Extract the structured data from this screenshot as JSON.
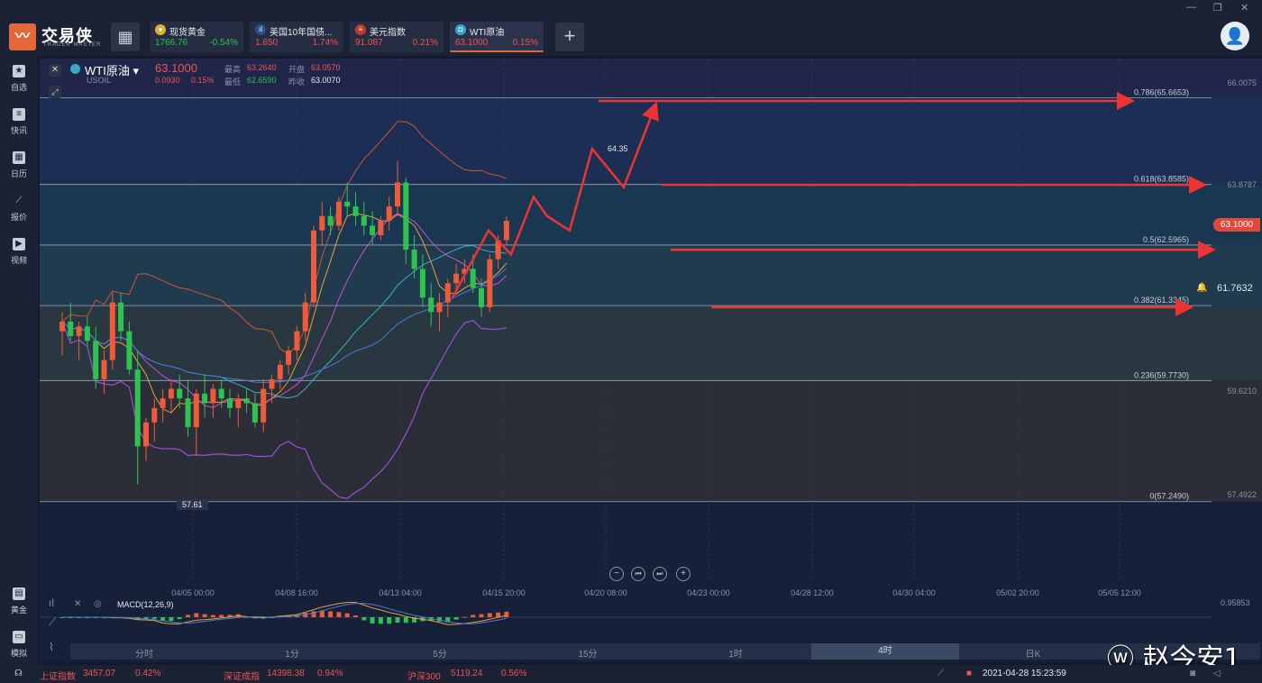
{
  "app": {
    "name": "交易侠",
    "subtitle": "TRADER MASTER"
  },
  "tabs": [
    {
      "name": "现货黄金",
      "price": "1766.76",
      "change": "-0.54%",
      "icon": "gold-coin-icon",
      "price_color": "#26c24f",
      "change_color": "#26c24f"
    },
    {
      "name": "美国10年国债...",
      "price": "1.650",
      "change": "1.74%",
      "icon": "bar-chart-icon",
      "price_color": "#ef5350",
      "change_color": "#ef5350"
    },
    {
      "name": "美元指数",
      "price": "91.087",
      "change": "0.21%",
      "icon": "us-flag-icon",
      "price_color": "#ef5350",
      "change_color": "#ef5350"
    },
    {
      "name": "WTI原油",
      "price": "63.1000",
      "change": "0.15%",
      "icon": "oil-drop-icon",
      "price_color": "#ef5350",
      "change_color": "#ef5350"
    }
  ],
  "sidebar": [
    {
      "label": "自选",
      "icon": "star-icon"
    },
    {
      "label": "快讯",
      "icon": "news-icon"
    },
    {
      "label": "日历",
      "icon": "calendar-icon"
    },
    {
      "label": "报价",
      "icon": "quote-line-icon"
    },
    {
      "label": "视频",
      "icon": "play-icon"
    },
    {
      "label": "黄金",
      "icon": "gold-bars-icon"
    },
    {
      "label": "模拟",
      "icon": "wallet-icon"
    }
  ],
  "symbol": {
    "name": "WTI原油",
    "code": "USOIL",
    "price": "63.1000",
    "change": "0.0930",
    "change_pct": "0.15%",
    "high_label": "最高",
    "high": "63.2640",
    "open_label": "开盘",
    "open": "63.0570",
    "low_label": "最低",
    "low": "62.6590",
    "prev_label": "昨收",
    "prev": "63.0070"
  },
  "price_axis": [
    "66.0075",
    "63.8787",
    "61.7632",
    "59.6210",
    "57.4922"
  ],
  "current_price_tag": "63.1000",
  "alert_price": "61.7632",
  "high_marker": "64.35",
  "low_marker": "57.61",
  "fib_levels": [
    {
      "label": "0.786(65.6653)",
      "value": 65.6653
    },
    {
      "label": "0.618(63.8585)",
      "value": 63.8585
    },
    {
      "label": "0.5(62.5965)",
      "value": 62.5965
    },
    {
      "label": "0.382(61.3345)",
      "value": 61.3345
    },
    {
      "label": "0.236(59.7730)",
      "value": 59.773
    },
    {
      "label": "0(57.2490)",
      "value": 57.249
    }
  ],
  "time_axis": [
    "04/05 00:00",
    "04/08 16:00",
    "04/13 04:00",
    "04/15 20:00",
    "04/20 08:00",
    "04/23 00:00",
    "04/28 12:00",
    "04/30 04:00",
    "05/02 20:00",
    "05/05 12:00"
  ],
  "macd": {
    "label": "MACD(12,26,9)",
    "axis": [
      "0.95853",
      "0.95853"
    ]
  },
  "timeframes": [
    "分时",
    "1分",
    "5分",
    "15分",
    "1时",
    "4时",
    "日K"
  ],
  "active_timeframe": "4时",
  "status": {
    "idx1_name": "上证指数",
    "idx1_val": "3457.07",
    "idx1_chg": "0.42%",
    "idx2_name": "深证成指",
    "idx2_val": "14398.38",
    "idx2_chg": "0.94%",
    "idx3_name": "沪深300",
    "idx3_val": "5119.24",
    "idx3_chg": "0.56%",
    "datetime": "2021-04-28 15:23:59"
  },
  "watermark": "赵今安1",
  "chart_data": {
    "type": "candlestick",
    "symbol": "USOIL",
    "ylim": [
      57.0,
      66.2
    ],
    "candles": [
      [
        60.8,
        61.2,
        60.3,
        61.0
      ],
      [
        61.0,
        61.4,
        60.6,
        60.7
      ],
      [
        60.7,
        61.0,
        60.2,
        60.9
      ],
      [
        60.9,
        61.1,
        60.5,
        60.6
      ],
      [
        60.6,
        60.9,
        59.6,
        59.8
      ],
      [
        59.8,
        60.4,
        59.5,
        60.2
      ],
      [
        60.2,
        61.6,
        60.0,
        61.4
      ],
      [
        61.4,
        61.6,
        60.6,
        60.8
      ],
      [
        60.8,
        61.0,
        59.9,
        60.0
      ],
      [
        60.0,
        60.4,
        57.61,
        58.4
      ],
      [
        58.4,
        59.0,
        58.1,
        58.9
      ],
      [
        58.9,
        59.4,
        58.5,
        59.2
      ],
      [
        59.2,
        59.6,
        58.9,
        59.4
      ],
      [
        59.4,
        59.8,
        59.1,
        59.6
      ],
      [
        59.6,
        59.9,
        59.2,
        59.4
      ],
      [
        59.4,
        59.8,
        58.6,
        58.8
      ],
      [
        58.8,
        59.6,
        58.2,
        59.5
      ],
      [
        59.5,
        59.9,
        59.0,
        59.3
      ],
      [
        59.3,
        59.7,
        59.0,
        59.6
      ],
      [
        59.6,
        59.8,
        59.2,
        59.4
      ],
      [
        59.4,
        59.6,
        59.0,
        59.2
      ],
      [
        59.2,
        59.5,
        58.8,
        59.4
      ],
      [
        59.4,
        59.6,
        59.1,
        59.3
      ],
      [
        59.3,
        59.5,
        58.8,
        58.9
      ],
      [
        58.9,
        59.8,
        58.7,
        59.6
      ],
      [
        59.6,
        59.9,
        59.3,
        59.8
      ],
      [
        59.8,
        60.2,
        59.6,
        60.1
      ],
      [
        60.1,
        60.5,
        59.9,
        60.4
      ],
      [
        60.4,
        60.9,
        60.2,
        60.8
      ],
      [
        60.8,
        61.6,
        60.6,
        61.4
      ],
      [
        61.4,
        63.0,
        61.3,
        62.9
      ],
      [
        62.9,
        63.5,
        62.6,
        63.2
      ],
      [
        63.2,
        63.4,
        62.8,
        63.0
      ],
      [
        63.0,
        63.6,
        62.9,
        63.5
      ],
      [
        63.5,
        63.9,
        63.2,
        63.4
      ],
      [
        63.4,
        63.7,
        63.0,
        63.2
      ],
      [
        63.2,
        63.5,
        62.8,
        63.0
      ],
      [
        63.0,
        63.3,
        62.6,
        62.8
      ],
      [
        62.8,
        63.2,
        62.7,
        63.1
      ],
      [
        63.1,
        63.6,
        62.9,
        63.4
      ],
      [
        63.4,
        64.35,
        63.2,
        63.9
      ],
      [
        63.9,
        64.0,
        62.2,
        62.5
      ],
      [
        62.5,
        62.8,
        61.9,
        62.1
      ],
      [
        62.1,
        62.4,
        61.3,
        61.5
      ],
      [
        61.5,
        61.8,
        60.9,
        61.2
      ],
      [
        61.2,
        61.6,
        60.8,
        61.4
      ],
      [
        61.4,
        61.9,
        61.1,
        61.8
      ],
      [
        61.8,
        62.2,
        61.6,
        62.0
      ],
      [
        62.0,
        62.3,
        61.8,
        62.1
      ],
      [
        62.1,
        62.4,
        61.6,
        61.7
      ],
      [
        61.7,
        61.9,
        61.1,
        61.3
      ],
      [
        61.3,
        62.4,
        61.2,
        62.3
      ],
      [
        62.3,
        62.8,
        62.1,
        62.7
      ],
      [
        62.7,
        63.2,
        62.6,
        63.1
      ]
    ]
  }
}
